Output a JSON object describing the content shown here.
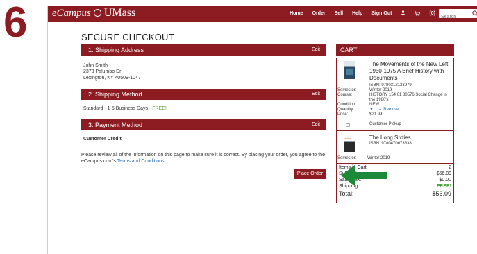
{
  "step": "6",
  "header": {
    "logo_ecampus": "eCampus",
    "logo_umass": "UMass",
    "nav": [
      "Home",
      "Order",
      "Sell",
      "Help",
      "Sign Out"
    ],
    "cart_count": "(0)",
    "search_placeholder": "Search",
    "brand_color": "#8c1c22"
  },
  "checkout": {
    "title": "SECURE CHECKOUT",
    "edit_label": "Edit",
    "shipping_address": {
      "title": "1. Shipping Address",
      "name": "John Smith",
      "street": "2373 Palumbo Dr",
      "city": "Lexington, KY 40509-1047"
    },
    "shipping_method": {
      "title": "2. Shipping Method",
      "text": "Standard - 1-5 Business Days - ",
      "free": "FREE!"
    },
    "payment_method": {
      "title": "3. Payment Method",
      "value": "Customer Credit"
    },
    "notice_text": "Please review all of the information on this page to make sure it is correct. By placing your order, you agree to the eCampus.com's ",
    "notice_link": "Terms and Conditions",
    "notice_end": ".",
    "place_order": "Place Order"
  },
  "cart": {
    "title": "CART",
    "item1": {
      "title": "The Movements of the New Left, 1950-1975 A Brief History with Documents",
      "isbn": "ISBN: 9780312133979",
      "semester_label": "Semester:",
      "semester": "Winter 2019",
      "course_label": "Course:",
      "course": "HISTORY 154 01 80576 Social Change in the 1960's",
      "condition_label": "Condition:",
      "condition": "NEW",
      "quantity_label": "Quantity:",
      "quantity": "1",
      "remove": "Remove",
      "price_label": "Price:",
      "price": "$21.99",
      "pickup": "Customer Pickup"
    },
    "item2": {
      "title": "The Long Sixties",
      "isbn": "ISBN: 9780470673638",
      "cover_text": "sixties",
      "semester_label": "Semester:",
      "semester": "Winter 2019"
    },
    "summary": {
      "items_label": "Items in Cart:",
      "items": "2",
      "subtotal_label": "Subtotal:",
      "subtotal": "$56.09",
      "tax_label": "Sales Tax:",
      "tax": "$0.00",
      "shipping_label": "Shipping:",
      "shipping": "FREE!",
      "total_label": "Total:",
      "total": "$56.09"
    }
  }
}
